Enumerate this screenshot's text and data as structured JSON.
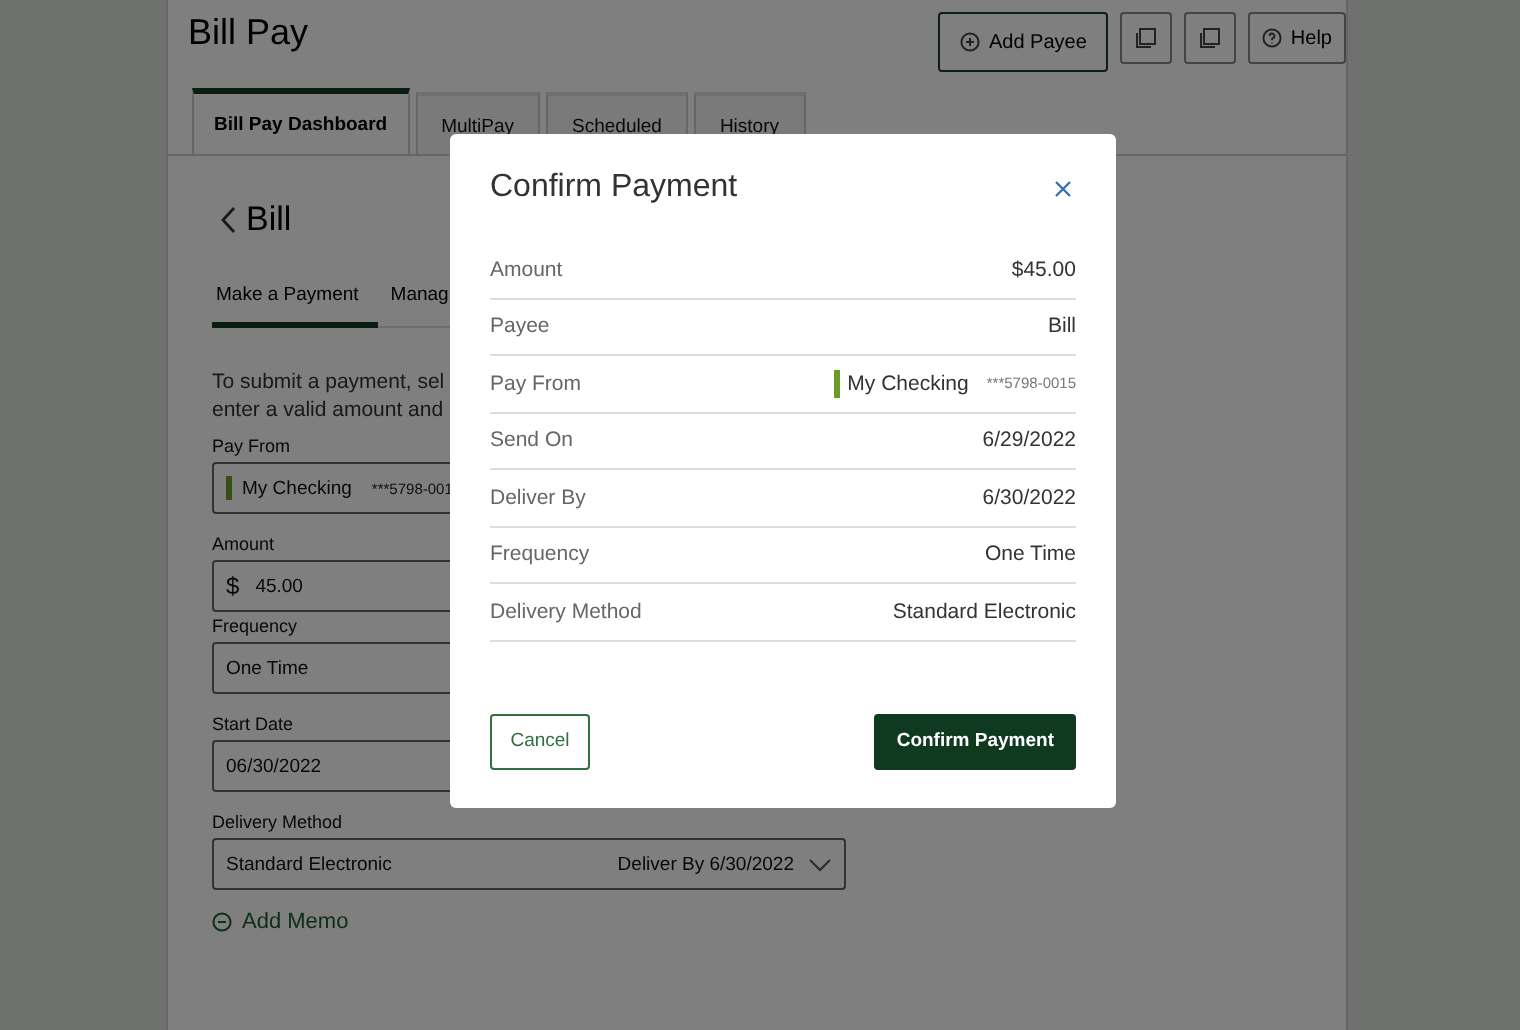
{
  "page": {
    "title": "Bill Pay",
    "header_buttons": [
      {
        "kind": "add",
        "label": "Add Payee"
      },
      {
        "kind": "document"
      },
      {
        "kind": "document"
      },
      {
        "kind": "help",
        "label": "Help"
      }
    ],
    "tabs": [
      {
        "label": "Bill Pay Dashboard",
        "selected": true
      },
      {
        "label": "MultiPay",
        "selected": false
      },
      {
        "label": "Scheduled",
        "selected": false
      },
      {
        "label": "History",
        "selected": false
      }
    ],
    "back_title": "Bill",
    "sub_tabs": [
      {
        "label": "Make a Payment",
        "selected": true
      },
      {
        "label": "Manag",
        "selected": false
      }
    ],
    "instructions": [
      "To submit a payment, sel",
      "enter a valid amount and"
    ],
    "fields": [
      {
        "kind": "account",
        "label": "Pay From",
        "value": "My Checking",
        "detail": "***5798-001"
      },
      {
        "kind": "amount",
        "label": "Amount",
        "prefix": "$",
        "value": "45.00"
      },
      {
        "kind": "select",
        "label": "Frequency",
        "value": "One Time"
      },
      {
        "kind": "date",
        "label": "Start Date",
        "value": "06/30/2022"
      },
      {
        "kind": "delivery",
        "label": "Delivery Method",
        "value": "Standard Electronic",
        "detail": "Deliver By 6/30/2022"
      }
    ],
    "add_memo": "Add Memo"
  },
  "dialog": {
    "title": "Confirm Payment",
    "rows": [
      {
        "label": "Amount",
        "value": "$45.00"
      },
      {
        "label": "Payee",
        "value": "Bill"
      },
      {
        "label": "Pay From",
        "kind": "account",
        "value": "My Checking",
        "detail": "***5798-0015"
      },
      {
        "label": "Send On",
        "value": "6/29/2022"
      },
      {
        "label": "Deliver By",
        "value": "6/30/2022"
      },
      {
        "label": "Frequency",
        "value": "One Time"
      },
      {
        "label": "Delivery Method",
        "value": "Standard Electronic"
      }
    ],
    "cancel": "Cancel",
    "confirm": "Confirm Payment"
  }
}
